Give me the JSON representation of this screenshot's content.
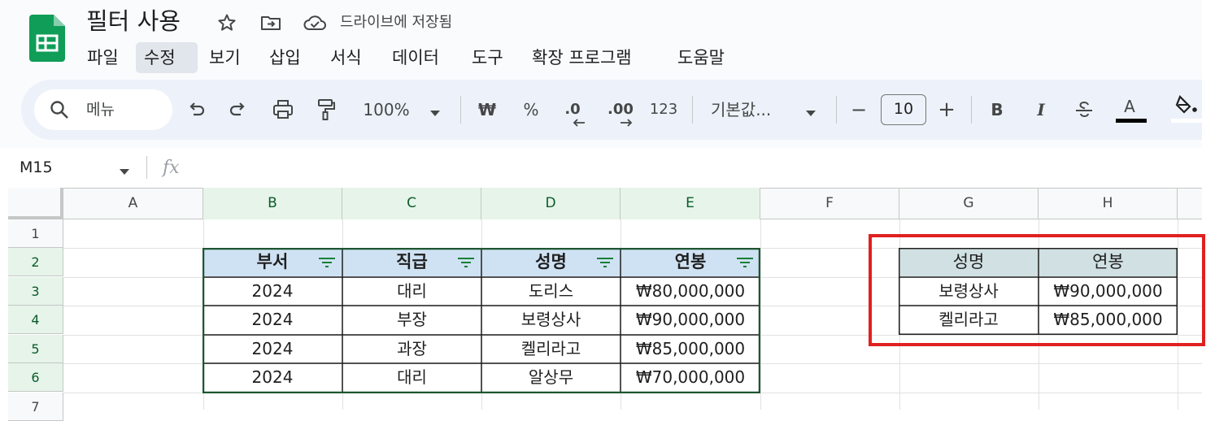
{
  "app": {
    "doc_title": "필터 사용",
    "save_status": "드라이브에 저장됨"
  },
  "menu": [
    "파일",
    "수정",
    "보기",
    "삽입",
    "서식",
    "데이터",
    "도구",
    "확장 프로그램",
    "도움말"
  ],
  "menu_active_index": 1,
  "toolbar": {
    "search_label": "메뉴",
    "zoom": "100%",
    "currency": "₩",
    "percent": "%",
    "decrease_decimal": ".0",
    "increase_decimal": ".00",
    "number_format": "123",
    "font": "기본값...",
    "minus": "−",
    "font_size": "10",
    "plus": "+",
    "bold": "B",
    "italic": "I",
    "text_color_label": "A"
  },
  "formula_bar": {
    "name_box": "M15",
    "fx": "fx"
  },
  "columns": [
    "A",
    "B",
    "C",
    "D",
    "E",
    "F",
    "G",
    "H"
  ],
  "rows": [
    "1",
    "2",
    "3",
    "4",
    "5",
    "6",
    "7"
  ],
  "table1": {
    "headers": [
      "부서",
      "직급",
      "성명",
      "연봉"
    ],
    "rows": [
      [
        "2024",
        "대리",
        "도리스",
        "₩80,000,000"
      ],
      [
        "2024",
        "부장",
        "보령상사",
        "₩90,000,000"
      ],
      [
        "2024",
        "과장",
        "켈리라고",
        "₩85,000,000"
      ],
      [
        "2024",
        "대리",
        "알상무",
        "₩70,000,000"
      ]
    ]
  },
  "table2": {
    "headers": [
      "성명",
      "연봉"
    ],
    "rows": [
      [
        "보령상사",
        "₩90,000,000"
      ],
      [
        "켈리라고",
        "₩85,000,000"
      ]
    ]
  },
  "colors": {
    "sheets_green": "#0f9d58",
    "header_blue": "#cfe2f3",
    "header_teal": "#d0e0e3",
    "table_border": "#1e5631",
    "highlight_red": "#e02020",
    "selected_header": "#e6f4ea"
  }
}
